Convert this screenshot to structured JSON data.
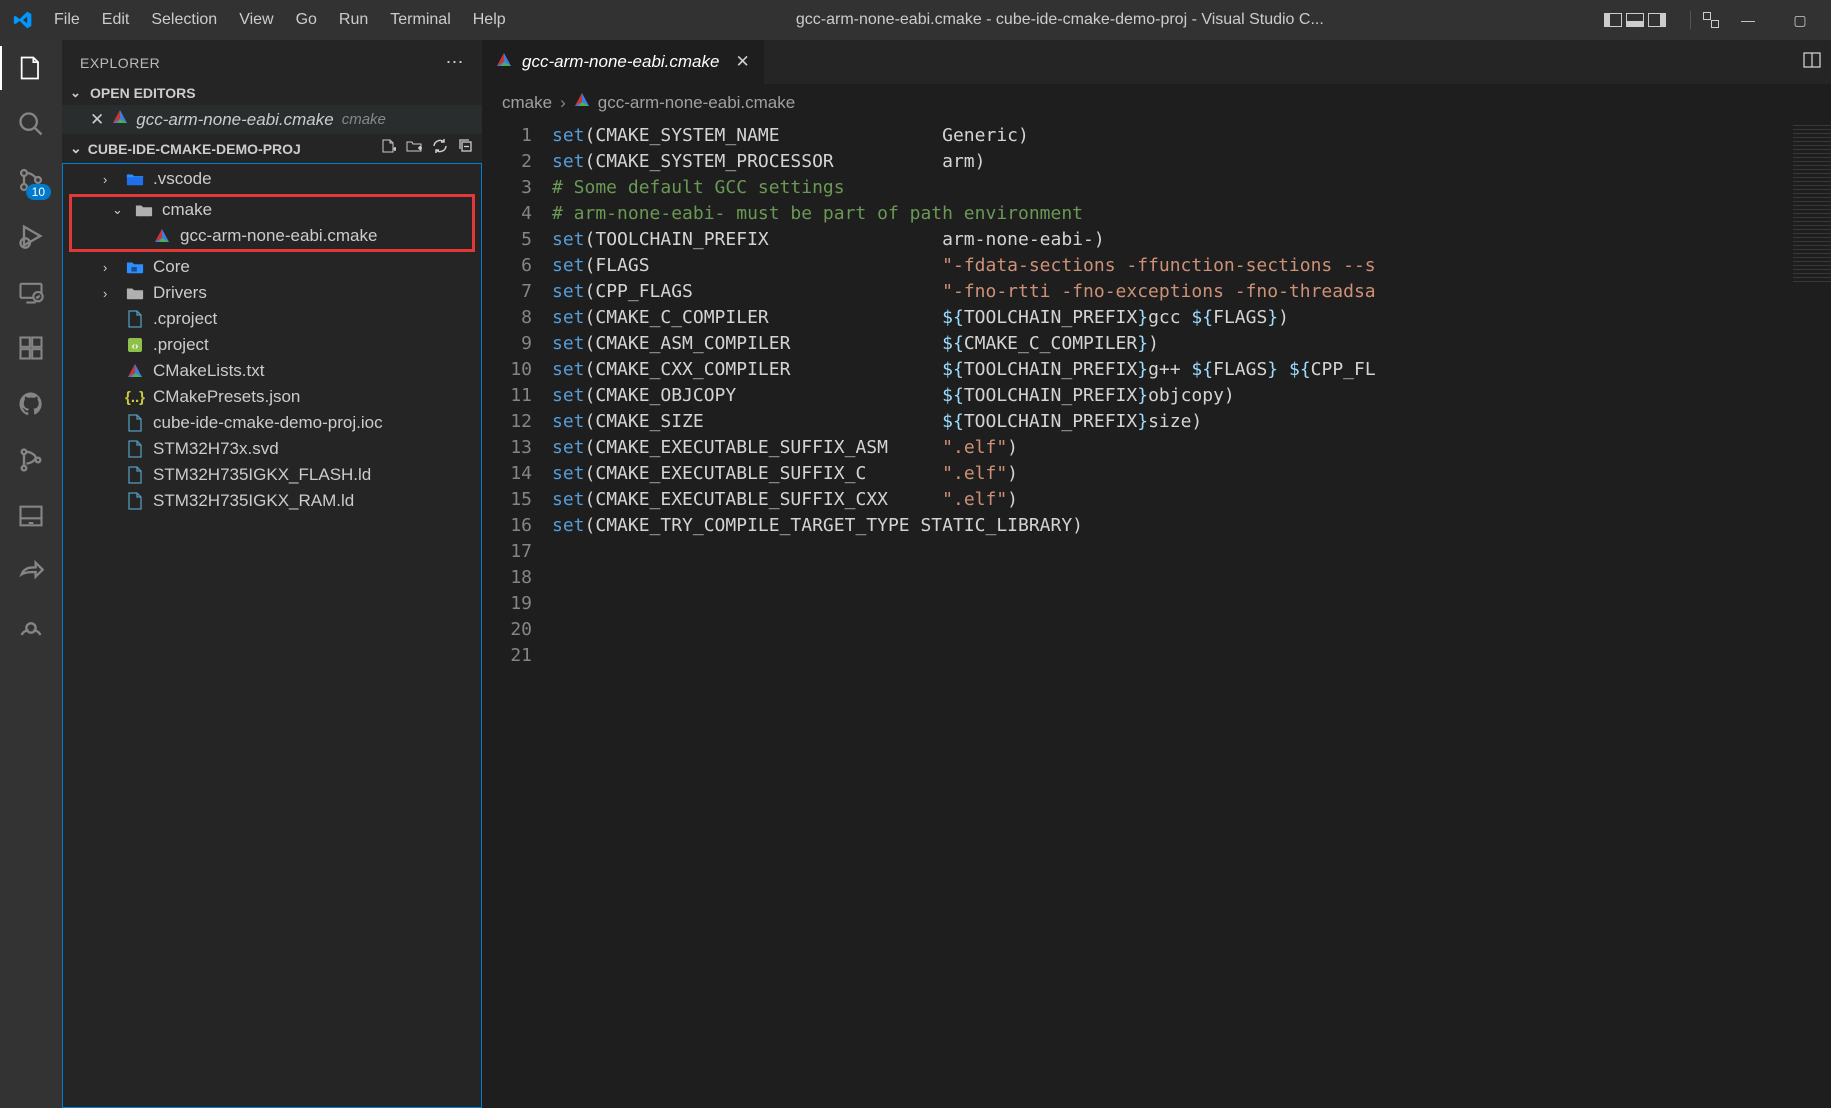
{
  "menu": [
    "File",
    "Edit",
    "Selection",
    "View",
    "Go",
    "Run",
    "Terminal",
    "Help"
  ],
  "title": "gcc-arm-none-eabi.cmake - cube-ide-cmake-demo-proj - Visual Studio C...",
  "explorer": {
    "title": "EXPLORER",
    "open_editors_label": "OPEN EDITORS",
    "open_file": "gcc-arm-none-eabi.cmake",
    "open_file_dir": "cmake",
    "project": "CUBE-IDE-CMAKE-DEMO-PROJ",
    "tree": {
      "vscode": ".vscode",
      "cmake_folder": "cmake",
      "cmake_file": "gcc-arm-none-eabi.cmake",
      "core": "Core",
      "drivers": "Drivers",
      "cproject": ".cproject",
      "project": ".project",
      "cmakelists": "CMakeLists.txt",
      "presets": "CMakePresets.json",
      "ioc": "cube-ide-cmake-demo-proj.ioc",
      "svd": "STM32H73x.svd",
      "flashld": "STM32H735IGKX_FLASH.ld",
      "ramld": "STM32H735IGKX_RAM.ld"
    }
  },
  "scm_badge": "10",
  "tab": {
    "filename": "gcc-arm-none-eabi.cmake"
  },
  "breadcrumb": {
    "folder": "cmake",
    "file": "gcc-arm-none-eabi.cmake"
  },
  "code_lines": [
    {
      "n": 1,
      "t": [
        [
          "kw",
          "set"
        ],
        [
          "",
          "(CMAKE_SYSTEM_NAME               Generic)"
        ]
      ]
    },
    {
      "n": 2,
      "t": [
        [
          "kw",
          "set"
        ],
        [
          "",
          "(CMAKE_SYSTEM_PROCESSOR          arm)"
        ]
      ]
    },
    {
      "n": 3,
      "t": [
        [
          "",
          ""
        ]
      ]
    },
    {
      "n": 4,
      "t": [
        [
          "cm",
          "# Some default GCC settings"
        ]
      ]
    },
    {
      "n": 5,
      "t": [
        [
          "cm",
          "# arm-none-eabi- must be part of path environment"
        ]
      ]
    },
    {
      "n": 6,
      "t": [
        [
          "kw",
          "set"
        ],
        [
          "",
          "(TOOLCHAIN_PREFIX                arm-none-eabi-)"
        ]
      ]
    },
    {
      "n": 7,
      "t": [
        [
          "kw",
          "set"
        ],
        [
          "",
          "(FLAGS                           "
        ],
        [
          "str",
          "\"-fdata-sections -ffunction-sections --s"
        ]
      ]
    },
    {
      "n": 8,
      "t": [
        [
          "kw",
          "set"
        ],
        [
          "",
          "(CPP_FLAGS                       "
        ],
        [
          "str",
          "\"-fno-rtti -fno-exceptions -fno-threadsa"
        ]
      ]
    },
    {
      "n": 9,
      "t": [
        [
          "",
          ""
        ]
      ]
    },
    {
      "n": 10,
      "t": [
        [
          "kw",
          "set"
        ],
        [
          "",
          "(CMAKE_C_COMPILER                "
        ],
        [
          "var",
          "${"
        ],
        [
          "",
          "TOOLCHAIN_PREFIX"
        ],
        [
          "var",
          "}"
        ],
        [
          "",
          "gcc "
        ],
        [
          "var",
          "${"
        ],
        [
          "",
          "FLAGS"
        ],
        [
          "var",
          "}"
        ],
        [
          "",
          ")"
        ]
      ]
    },
    {
      "n": 11,
      "t": [
        [
          "kw",
          "set"
        ],
        [
          "",
          "(CMAKE_ASM_COMPILER              "
        ],
        [
          "var",
          "${"
        ],
        [
          "",
          "CMAKE_C_COMPILER"
        ],
        [
          "var",
          "}"
        ],
        [
          "",
          ")"
        ]
      ]
    },
    {
      "n": 12,
      "t": [
        [
          "kw",
          "set"
        ],
        [
          "",
          "(CMAKE_CXX_COMPILER              "
        ],
        [
          "var",
          "${"
        ],
        [
          "",
          "TOOLCHAIN_PREFIX"
        ],
        [
          "var",
          "}"
        ],
        [
          "",
          "g++ "
        ],
        [
          "var",
          "${"
        ],
        [
          "",
          "FLAGS"
        ],
        [
          "var",
          "}"
        ],
        [
          "",
          " "
        ],
        [
          "var",
          "${"
        ],
        [
          "",
          "CPP_FL"
        ]
      ]
    },
    {
      "n": 13,
      "t": [
        [
          "kw",
          "set"
        ],
        [
          "",
          "(CMAKE_OBJCOPY                   "
        ],
        [
          "var",
          "${"
        ],
        [
          "",
          "TOOLCHAIN_PREFIX"
        ],
        [
          "var",
          "}"
        ],
        [
          "",
          "objcopy)"
        ]
      ]
    },
    {
      "n": 14,
      "t": [
        [
          "kw",
          "set"
        ],
        [
          "",
          "(CMAKE_SIZE                      "
        ],
        [
          "var",
          "${"
        ],
        [
          "",
          "TOOLCHAIN_PREFIX"
        ],
        [
          "var",
          "}"
        ],
        [
          "",
          "size)"
        ]
      ]
    },
    {
      "n": 15,
      "t": [
        [
          "",
          ""
        ]
      ]
    },
    {
      "n": 16,
      "t": [
        [
          "kw",
          "set"
        ],
        [
          "",
          "(CMAKE_EXECUTABLE_SUFFIX_ASM     "
        ],
        [
          "str",
          "\".elf\""
        ],
        [
          "",
          ")"
        ]
      ]
    },
    {
      "n": 17,
      "t": [
        [
          "kw",
          "set"
        ],
        [
          "",
          "(CMAKE_EXECUTABLE_SUFFIX_C       "
        ],
        [
          "str",
          "\".elf\""
        ],
        [
          "",
          ")"
        ]
      ]
    },
    {
      "n": 18,
      "t": [
        [
          "kw",
          "set"
        ],
        [
          "",
          "(CMAKE_EXECUTABLE_SUFFIX_CXX     "
        ],
        [
          "str",
          "\".elf\""
        ],
        [
          "",
          ")"
        ]
      ]
    },
    {
      "n": 19,
      "t": [
        [
          "",
          ""
        ]
      ]
    },
    {
      "n": 20,
      "t": [
        [
          "kw",
          "set"
        ],
        [
          "",
          "(CMAKE_TRY_COMPILE_TARGET_TYPE STATIC_LIBRARY)"
        ]
      ]
    },
    {
      "n": 21,
      "t": [
        [
          "",
          ""
        ]
      ]
    }
  ]
}
